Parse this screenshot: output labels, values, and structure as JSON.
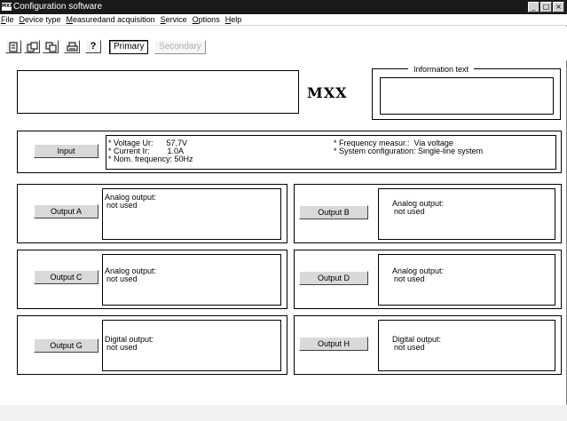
{
  "window": {
    "logo": "MXX",
    "title": "Configuration software",
    "controls": [
      "_",
      "□",
      "×"
    ]
  },
  "menu": [
    "File",
    "Device type",
    "Measuredand acquisition",
    "Service",
    "Options",
    "Help"
  ],
  "toolbar": {
    "icons": [
      "new-file-icon",
      "open-file-icon",
      "save-file-icon",
      "print-icon",
      "help-icon"
    ],
    "help_label": "?",
    "primary_label": "Primary",
    "secondary_label": "Secondary"
  },
  "header": {
    "device_logo": "MXX",
    "info_label": "Information text",
    "info_value": ""
  },
  "input": {
    "button": "Input",
    "left_lines": [
      "* Voltage Ur:      57.7V",
      "* Current Ir:        1.0A",
      "* Nom. frequency: 50Hz"
    ],
    "right_lines": [
      "* Frequency measur.:  Via voltage",
      "* System configuration: Single-line system"
    ]
  },
  "outputs": [
    {
      "button": "Output A",
      "type": "Analog output:",
      "status": "not used"
    },
    {
      "button": "Output B",
      "type": "Analog output:",
      "status": "not used"
    },
    {
      "button": "Output C",
      "type": "Analog output:",
      "status": "not used"
    },
    {
      "button": "Output D",
      "type": "Analog output:",
      "status": "not used"
    },
    {
      "button": "Output G",
      "type": "Digital output:",
      "status": "not used"
    },
    {
      "button": "Output H",
      "type": "Digital output:",
      "status": "not used"
    }
  ]
}
